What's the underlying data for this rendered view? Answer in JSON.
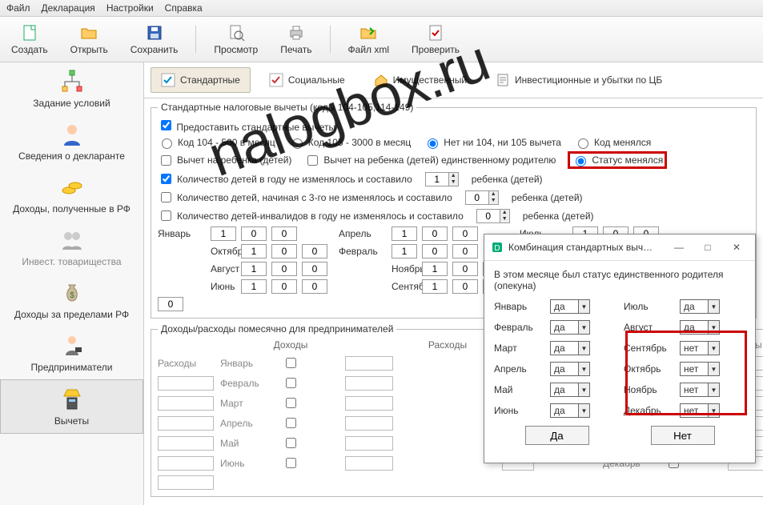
{
  "menubar": [
    "Файл",
    "Декларация",
    "Настройки",
    "Справка"
  ],
  "toolbar": [
    {
      "id": "new",
      "label": "Создать"
    },
    {
      "id": "open",
      "label": "Открыть"
    },
    {
      "id": "save",
      "label": "Сохранить"
    },
    {
      "id": "preview",
      "label": "Просмотр"
    },
    {
      "id": "print",
      "label": "Печать"
    },
    {
      "id": "xml",
      "label": "Файл xml"
    },
    {
      "id": "check",
      "label": "Проверить"
    }
  ],
  "sidebar": [
    {
      "id": "conditions",
      "label": "Задание условий"
    },
    {
      "id": "declarant",
      "label": "Сведения о декларанте"
    },
    {
      "id": "income-rf",
      "label": "Доходы, полученные в РФ"
    },
    {
      "id": "invest",
      "label": "Инвест. товарищества"
    },
    {
      "id": "income-out",
      "label": "Доходы за пределами РФ"
    },
    {
      "id": "entrepreneurs",
      "label": "Предприниматели"
    },
    {
      "id": "deductions",
      "label": "Вычеты"
    }
  ],
  "tabs": [
    {
      "id": "standard",
      "label": "Стандартные"
    },
    {
      "id": "social",
      "label": "Социальные"
    },
    {
      "id": "property",
      "label": "Имущественный"
    },
    {
      "id": "invest-loss",
      "label": "Инвестиционные и убытки по ЦБ"
    }
  ],
  "section": {
    "legend": "Стандартные налоговые вычеты (коды 104-105,114-149)",
    "provide_cb": "Предоставить стандартные вычеты",
    "code_group": {
      "opt104": "Код 104 - 500 в месяц",
      "opt105": "Код 105 - 3000 в месяц",
      "opt_none": "Нет ни 104, ни 105 вычета",
      "opt_changed": "Код менялся"
    },
    "child_row": {
      "child": "Вычет на ребенка (детей)",
      "single": "Вычет на ребенка (детей) единственному родителю",
      "status_changed": "Статус менялся"
    },
    "counts": {
      "c1": "Количество детей в году не изменялось и составило",
      "c2": "Количество детей, начиная с 3-го не изменялось и составило",
      "c3": "Количество детей-инвалидов в году не изменялось и составило",
      "suffix": "ребенка (детей)",
      "v1": "1",
      "v2": "0",
      "v3": "0"
    },
    "months": {
      "labels": [
        "Январь",
        "Февраль",
        "Март",
        "Апрель",
        "Май",
        "Июнь",
        "Июль",
        "Август",
        "Сентябрь",
        "Октябрь",
        "Ноябрь",
        "Декабрь"
      ],
      "default1": "1",
      "default0": "0"
    },
    "ie": {
      "legend": "Доходы/расходы помесячно для предпринимателей",
      "income": "Доходы",
      "expense": "Расходы"
    }
  },
  "dialog": {
    "title": "Комбинация стандартных выч…",
    "text": "В этом месяце был статус единственного родителя (опекуна)",
    "left": [
      {
        "m": "Январь",
        "v": "да"
      },
      {
        "m": "Февраль",
        "v": "да"
      },
      {
        "m": "Март",
        "v": "да"
      },
      {
        "m": "Апрель",
        "v": "да"
      },
      {
        "m": "Май",
        "v": "да"
      },
      {
        "m": "Июнь",
        "v": "да"
      }
    ],
    "right": [
      {
        "m": "Июль",
        "v": "да"
      },
      {
        "m": "Август",
        "v": "да"
      },
      {
        "m": "Сентябрь",
        "v": "нет"
      },
      {
        "m": "Октябрь",
        "v": "нет"
      },
      {
        "m": "Ноябрь",
        "v": "нет"
      },
      {
        "m": "Декабрь",
        "v": "нет"
      }
    ],
    "yes": "Да",
    "no": "Нет"
  },
  "watermark": "nalogbox.ru"
}
